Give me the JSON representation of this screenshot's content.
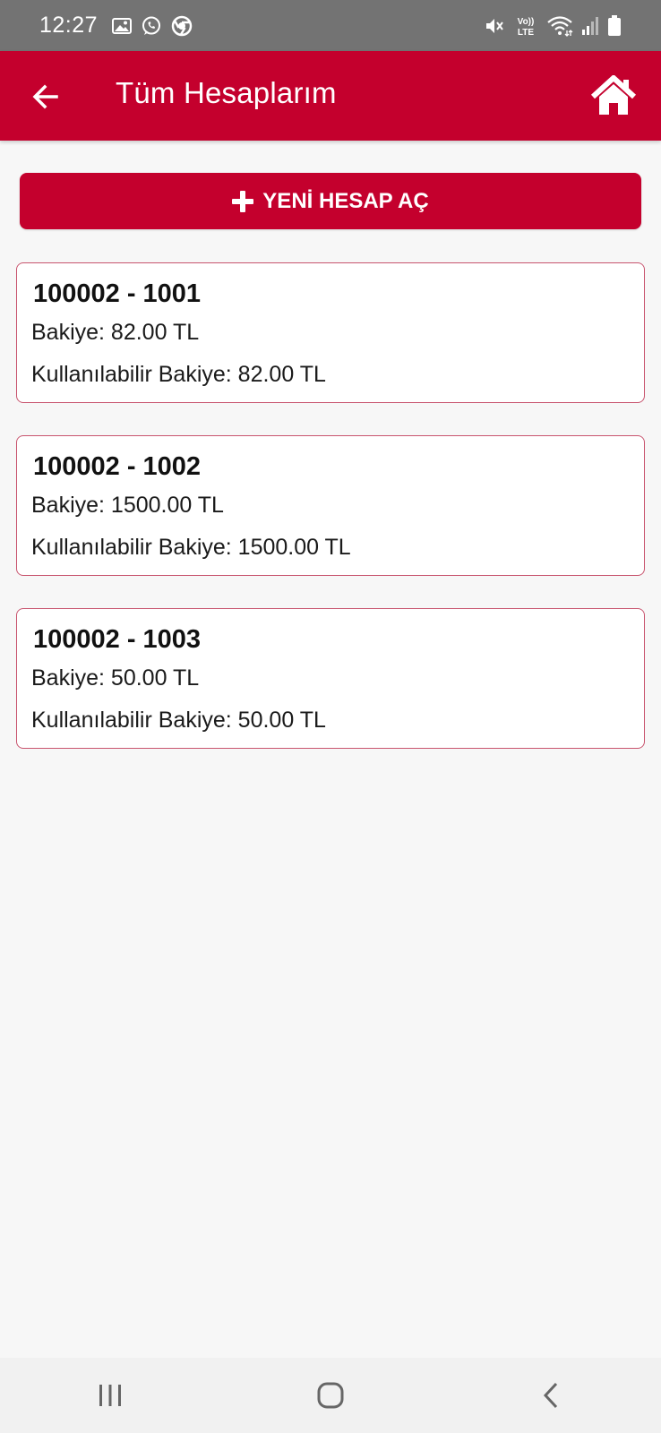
{
  "status_bar": {
    "time": "12:27",
    "left_icons": [
      "image-icon",
      "whatsapp-icon",
      "chrome-icon"
    ],
    "right_icons": [
      "mute-icon",
      "volte-icon",
      "wifi-icon",
      "signal-icon",
      "battery-icon"
    ],
    "volte_text_top": "Vo))",
    "volte_text_bottom": "LTE"
  },
  "app_bar": {
    "title": "Tüm Hesaplarım",
    "back_icon": "arrow-left-icon",
    "home_icon": "home-icon"
  },
  "new_account_button": {
    "label": "YENİ HESAP AÇ",
    "icon": "plus-icon"
  },
  "accounts": [
    {
      "number": "100002 - 1001",
      "balance": "Bakiye: 82.00 TL",
      "available": "Kullanılabilir Bakiye: 82.00 TL"
    },
    {
      "number": "100002 - 1002",
      "balance": "Bakiye: 1500.00 TL",
      "available": "Kullanılabilir Bakiye: 1500.00 TL"
    },
    {
      "number": "100002 - 1003",
      "balance": "Bakiye: 50.00 TL",
      "available": "Kullanılabilir Bakiye: 50.00 TL"
    }
  ],
  "nav_bar": {
    "buttons": [
      "recents-icon",
      "home-nav-icon",
      "back-nav-icon"
    ]
  },
  "colors": {
    "brand_red": "#c4002d",
    "status_bar": "#737373",
    "background": "#f7f7f7",
    "card_border": "#c8546e"
  }
}
